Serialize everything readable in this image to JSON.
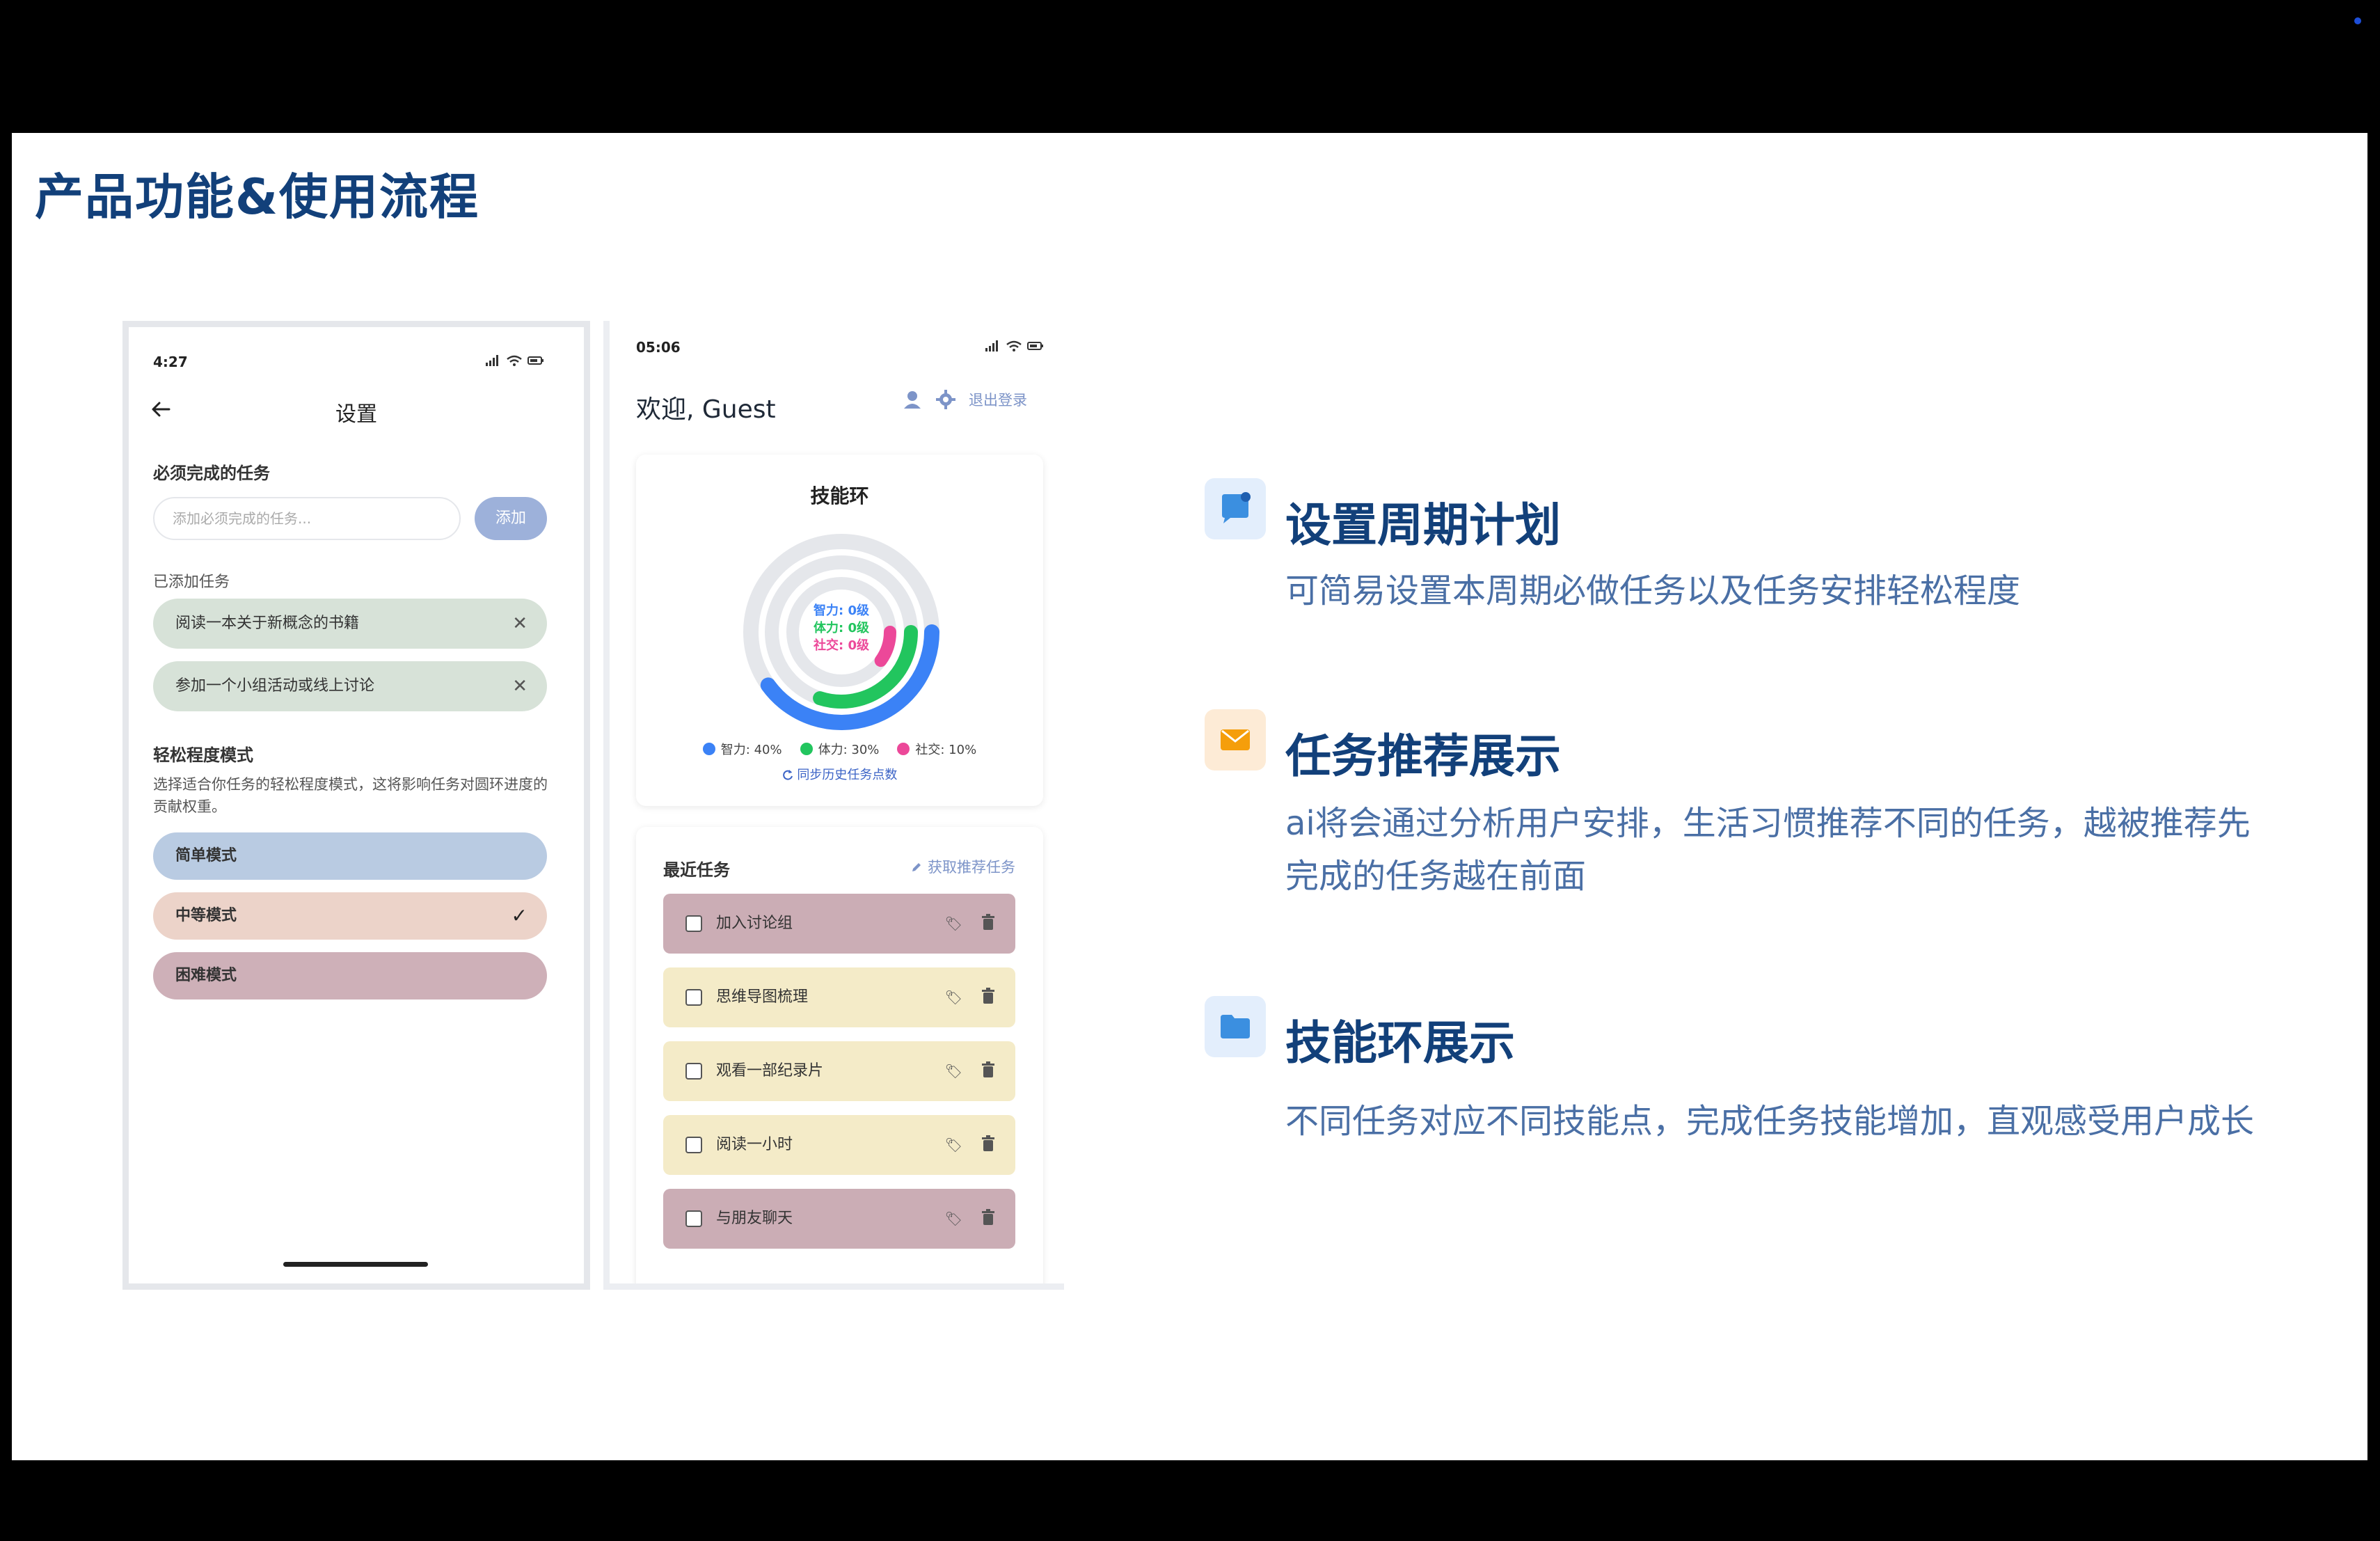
{
  "slide": {
    "title": "产品功能&使用流程"
  },
  "phone1": {
    "time": "4:27",
    "title": "设置",
    "required_label": "必须完成的任务",
    "input_placeholder": "添加必须完成的任务...",
    "add_button": "添加",
    "added_label": "已添加任务",
    "tasks": [
      {
        "label": "阅读一本关于新概念的书籍"
      },
      {
        "label": "参加一个小组活动或线上讨论"
      }
    ],
    "mode_label": "轻松程度模式",
    "mode_desc": "选择适合你任务的轻松程度模式，这将影响任务对圆环进度的贡献权重。",
    "modes": [
      {
        "label": "简单模式",
        "color": "#b9cbe2",
        "selected": false
      },
      {
        "label": "中等模式",
        "color": "#ecd3c9",
        "selected": true
      },
      {
        "label": "困难模式",
        "color": "#ceb0b8",
        "selected": false
      }
    ]
  },
  "phone2": {
    "time": "05:06",
    "welcome": "欢迎, Guest",
    "logout": "退出登录",
    "skill_card": {
      "title": "技能环",
      "ring_labels": [
        "智力: 0级",
        "体力: 0级",
        "社交: 0级"
      ],
      "legend": [
        {
          "label": "智力: 40%",
          "color": "#3b82f6",
          "value": 40
        },
        {
          "label": "体力: 30%",
          "color": "#22c55e",
          "value": 30
        },
        {
          "label": "社交: 10%",
          "color": "#ec4899",
          "value": 10
        }
      ],
      "sync": "同步历史任务点数"
    },
    "recent": {
      "title": "最近任务",
      "get_recommend": "获取推荐任务",
      "tasks": [
        {
          "label": "加入讨论组",
          "color": "#cbadb5"
        },
        {
          "label": "思维导图梳理",
          "color": "#f4ebc8"
        },
        {
          "label": "观看一部纪录片",
          "color": "#f4ebc8"
        },
        {
          "label": "阅读一小时",
          "color": "#f4ebc8"
        },
        {
          "label": "与朋友聊天",
          "color": "#cbadb5"
        }
      ]
    }
  },
  "features": [
    {
      "title": "设置周期计划",
      "desc": "可简易设置本周期必做任务以及任务安排轻松程度",
      "icon": "chat-flag-icon"
    },
    {
      "title": "任务推荐展示",
      "desc": "ai将会通过分析用户安排，生活习惯推荐不同的任务，越被推荐先完成的任务越在前面",
      "icon": "mail-icon"
    },
    {
      "title": "技能环展示",
      "desc": "不同任务对应不同技能点，完成任务技能增加，直观感受用户成长",
      "icon": "folder-icon"
    }
  ]
}
